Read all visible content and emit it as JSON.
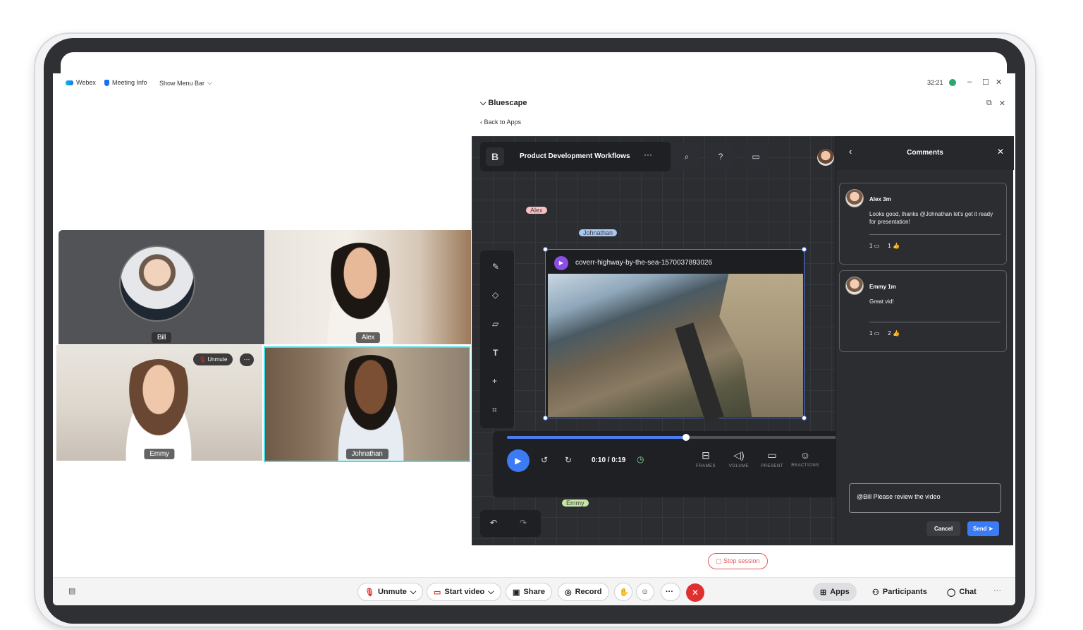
{
  "titlebar": {
    "app_name": "Webex",
    "meeting_info": "Meeting Info",
    "show_menu_bar": "Show Menu Bar",
    "timer": "32:21"
  },
  "participants_grid": [
    {
      "name": "Bill"
    },
    {
      "name": "Alex"
    },
    {
      "name": "Emmy",
      "unmute_label": "Unmute",
      "more": "···"
    },
    {
      "name": "Johnathan"
    }
  ],
  "bluescape": {
    "title": "Bluescape",
    "back": "Back to Apps",
    "workspace_name": "Product Development Workflows",
    "logo": "B",
    "cursors": [
      {
        "name": "Alex",
        "color": "#f7c1c1"
      },
      {
        "name": "Johnathan",
        "color": "#a9c7f5"
      },
      {
        "name": "Emmy",
        "color": "#c7e6a3"
      }
    ],
    "video": {
      "filename": "coverr-highway-by-the-sea-1570037893026",
      "time": "0:10 / 0:19",
      "progress": 0.54
    },
    "media_tools": [
      {
        "label": "FRAMES",
        "icon": "frames-icon"
      },
      {
        "label": "VOLUME",
        "icon": "volume-icon"
      },
      {
        "label": "PRESENT",
        "icon": "present-icon"
      },
      {
        "label": "REACTIONS",
        "icon": "reactions-icon"
      }
    ],
    "comments": {
      "title": "Comments",
      "items": [
        {
          "author": "Alex  3m",
          "text": "Looks good, thanks @Johnathan let's get it ready for presentation!",
          "replies": "1",
          "likes": "1"
        },
        {
          "author": "Emmy  1m",
          "text": "Great vid!",
          "replies": "1",
          "likes": "2"
        }
      ],
      "input_value": "@Bill Please review the video",
      "cancel": "Cancel",
      "send": "Send"
    },
    "stop_session": "Stop session"
  },
  "bottombar": {
    "unmute": "Unmute",
    "start_video": "Start video",
    "share": "Share",
    "record": "Record",
    "apps": "Apps",
    "participants": "Participants",
    "chat": "Chat"
  }
}
